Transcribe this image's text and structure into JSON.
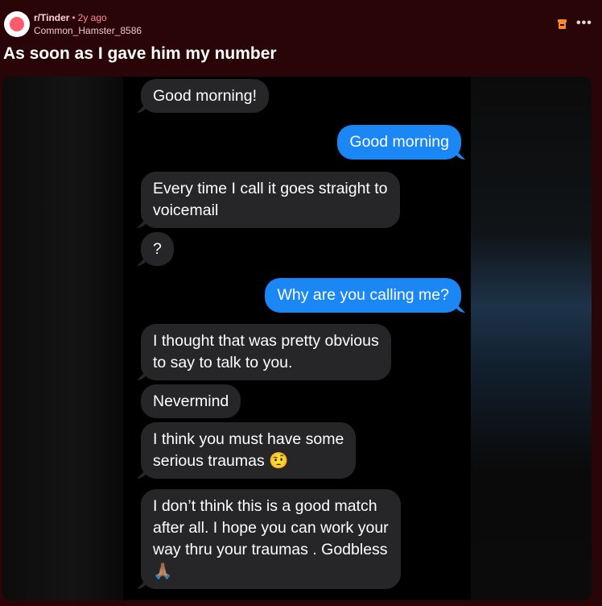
{
  "post": {
    "subreddit": "r/Tinder",
    "separator": "•",
    "age": "2y ago",
    "username": "Common_Hamster_8586",
    "more_label": "•••",
    "title": "As soon as I gave him my number"
  },
  "messages": [
    {
      "from": "them",
      "text": "Good morning!"
    },
    {
      "from": "me",
      "text": "Good morning"
    },
    {
      "from": "them",
      "text": "Every time I call it goes straight to\nvoicemail"
    },
    {
      "from": "them",
      "text": "?"
    },
    {
      "from": "me",
      "text": "Why are you calling me?"
    },
    {
      "from": "them",
      "text": "I thought that was pretty obvious\nto say to talk to you."
    },
    {
      "from": "them",
      "text": "Nevermind"
    },
    {
      "from": "them",
      "text": "I think you must have some\nserious traumas 🤨"
    },
    {
      "from": "them",
      "text": "I don’t think this is a good match\nafter all. I hope you can work your\nway thru your traumas . Godbless\n🙏🏽"
    }
  ],
  "colors": {
    "background": "#2a0508",
    "incoming_bubble": "#262628",
    "outgoing_bubble": "#1a87f5"
  }
}
